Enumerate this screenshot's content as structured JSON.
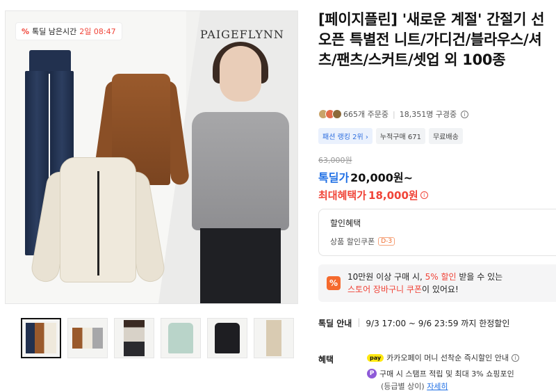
{
  "image": {
    "timer_label": "톡딜 남은시간",
    "timer_value": "2일 08:47",
    "brand": "PAIGEFLYNN"
  },
  "thumbnails": [
    {
      "name": "thumb-1"
    },
    {
      "name": "thumb-2"
    },
    {
      "name": "thumb-3"
    },
    {
      "name": "thumb-4"
    },
    {
      "name": "thumb-5"
    },
    {
      "name": "thumb-6"
    }
  ],
  "product": {
    "title": "[페이지플린] '새로운 계절' 간절기 선 오픈 특별전 니트/가디건/블라우스/셔츠/팬츠/스커트/셋업 외 100종",
    "orders": "665개 주문중",
    "subscribers": "18,351명 구경중",
    "tags": [
      "패션 랭킹 2위 ›",
      "누적구매 671",
      "무료배송"
    ],
    "original_price": "63,000원",
    "deal_label": "톡딜가",
    "deal_price": "20,000원~",
    "max_label": "최대혜택가",
    "max_price": "18,000원"
  },
  "discount": {
    "header": "할인혜택",
    "coupon_label": "상품 할인쿠폰",
    "coupon_chip": "D-3"
  },
  "promo": {
    "icon": "%",
    "line1_a": "10만원 이상 구매 시, ",
    "line1_hl": "5% 할인",
    "line1_b": " 받을 수 있는",
    "line2_hl": "스토어 장바구니 쿠폰",
    "line2_b": "이 있어요!"
  },
  "limited": {
    "label": "톡딜 안내",
    "text": "9/3 17:00 ~ 9/6 23:59 까지 한정할인"
  },
  "benefits": {
    "label": "혜택",
    "kakao_badge": "pay",
    "kakao_text": "카카오페이 머니 선착순 즉시할인 안내",
    "stamp_icon": "P",
    "stamp_text": "구매 시 스탬프 적립 및 최대 3% 쇼핑포인",
    "grade_text": "(등급별 상이)",
    "detail_link": "자세히"
  }
}
